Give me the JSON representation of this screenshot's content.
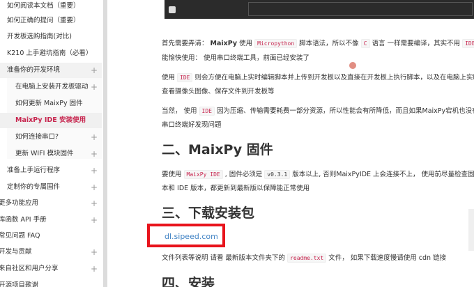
{
  "sidebar": {
    "items": [
      {
        "label": "如何阅读本文档（重要）",
        "level": 0,
        "plus": false
      },
      {
        "label": "如何正确的提问（重要）",
        "level": 0,
        "plus": false
      },
      {
        "label": "开发板选购指南(对比)",
        "level": 0,
        "plus": false
      },
      {
        "label": "K210 上手避坑指南（必看）",
        "level": 0,
        "plus": false
      },
      {
        "label": "准备你的开发环境",
        "level": 0,
        "plus": true,
        "group": true
      },
      {
        "label": "在电脑上安装开发板驱动",
        "level": 1,
        "plus": true
      },
      {
        "label": "如何更新 MaixPy 固件",
        "level": 1,
        "plus": false
      },
      {
        "label": "MaixPy IDE 安装使用",
        "level": 1,
        "plus": false,
        "active": true
      },
      {
        "label": "如何连接串口?",
        "level": 1,
        "plus": true
      },
      {
        "label": "更新 WIFI 模块固件",
        "level": 1,
        "plus": true
      },
      {
        "label": "准备上手运行程序",
        "level": 0,
        "plus": true
      },
      {
        "label": "定制你的专属固件",
        "level": 0,
        "plus": true
      },
      {
        "label": "更多功能应用",
        "level": 0,
        "plus": true
      },
      {
        "label": "库函数 API 手册",
        "level": 0,
        "plus": true
      },
      {
        "label": "常见问题 FAQ",
        "level": 0,
        "plus": false
      },
      {
        "label": "开发与贡献",
        "level": 0,
        "plus": true
      },
      {
        "label": "来自社区和用户分享",
        "level": 0,
        "plus": true
      },
      {
        "label": "开源项目歌谢",
        "level": 0,
        "plus": false
      }
    ]
  },
  "content": {
    "para1_a": "首先需要弄清： ",
    "para1_b": "MaixPy",
    "para1_c": " 使用 ",
    "para1_code1": "Micropython",
    "para1_d": " 脚本语法，所以不像 ",
    "para1_code2": "C",
    "para1_e": " 语言 一样需要编译，其实不用 ",
    "para1_code3": "IDE",
    "para1_f": " 也",
    "para1_line2": "能愉快使用： 使用串口终端工具，前面已经安装了",
    "para2_a": "使用 ",
    "para2_code": "IDE",
    "para2_b": " 则会方便在电脑上实时编辑脚本并上传到开发板以及直接在开发板上执行脚本，以及在电脑上实时",
    "para2_line2": "查看摄像头图像、保存文件到开发板等",
    "para3_a": "当然， 使用 ",
    "para3_code": "IDE",
    "para3_b": " 因为压缩、传输需要耗费一部分资源，所以性能会有所降低，而且如果MaixPy宕机也没有",
    "para3_line2": "串口终端好发现问题",
    "h2": "二、MaixPy 固件",
    "para4_a": "要使用 ",
    "para4_code1": "MaixPy IDE",
    "para4_b": " , 固件必须是 ",
    "para4_code2": "v0.3.1",
    "para4_c": " 版本以上, 否则MaixPyIDE 上会连接不上， 使用前尽量检查固件",
    "para4_line2": "本和 IDE 版本，都更新到最新版以保障能正常使用",
    "h3": "三、下载安装包",
    "link": "dl.sipeed.com",
    "para5_a": "文件列表等说明 请看 最新版本文件夹下的 ",
    "para5_code": "readme.txt",
    "para5_b": " 文件， 如果下载速度慢请使用 cdn 链接",
    "h4": "四、安装"
  },
  "colors": {
    "accent": "#c7254e",
    "highlight_box": "#e8141c",
    "link": "#4183c4"
  }
}
